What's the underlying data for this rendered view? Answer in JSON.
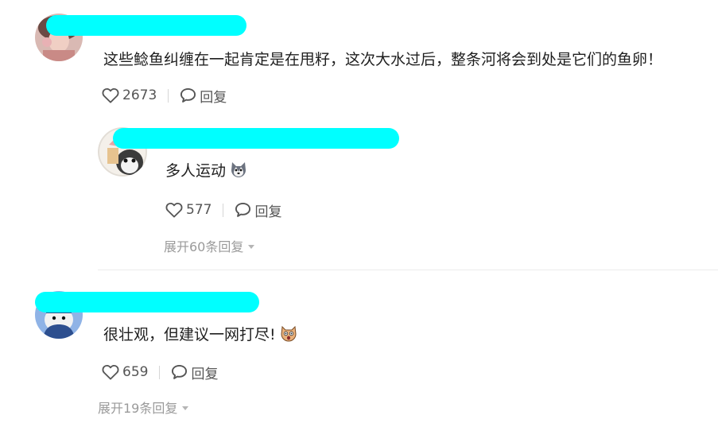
{
  "comments": [
    {
      "text": "这些鲶鱼纠缠在一起肯定是在甩籽，这次大水过后，整条河将会到处是它们的鱼卵！",
      "likes": "2673",
      "reply_label": "回复"
    },
    {
      "text": "多人运动",
      "emoji": "husky-dog-emoji",
      "likes": "577",
      "reply_label": "回复",
      "expand_label": "展开60条回复"
    },
    {
      "text": "很壮观，但建议一网打尽!",
      "emoji": "shocked-cat-emoji",
      "likes": "659",
      "reply_label": "回复",
      "expand_label": "展开19条回复"
    }
  ],
  "icons": {
    "like": "heart-outline-icon",
    "reply": "speech-bubble-icon",
    "expand": "caret-down-icon"
  },
  "colors": {
    "redaction": "#00ffff",
    "muted_text": "#9a9a9a",
    "action_text": "#555555"
  }
}
